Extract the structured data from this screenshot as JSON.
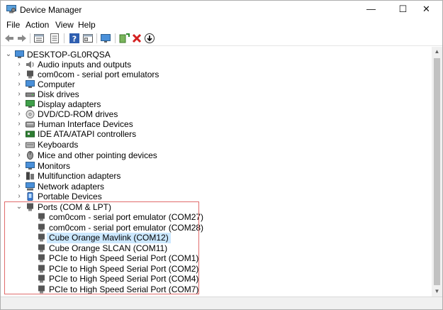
{
  "window": {
    "title": "Device Manager",
    "controls": {
      "minimize": "—",
      "maximize": "☐",
      "close": "✕"
    }
  },
  "menu": [
    "File",
    "Action",
    "View",
    "Help"
  ],
  "toolbar": [
    "back-icon",
    "forward-icon",
    "properties-view-icon",
    "list-view-icon",
    "help-icon",
    "details-view-icon",
    "monitor-icon",
    "add-driver-icon",
    "uninstall-icon",
    "update-driver-icon"
  ],
  "tree": {
    "root": "DESKTOP-GL0RQSA",
    "categories": [
      {
        "label": "Audio inputs and outputs",
        "icon": "speaker-icon"
      },
      {
        "label": "com0com - serial port emulators",
        "icon": "port-icon"
      },
      {
        "label": "Computer",
        "icon": "computer-icon"
      },
      {
        "label": "Disk drives",
        "icon": "disk-icon"
      },
      {
        "label": "Display adapters",
        "icon": "display-icon"
      },
      {
        "label": "DVD/CD-ROM drives",
        "icon": "dvd-icon"
      },
      {
        "label": "Human Interface Devices",
        "icon": "hid-icon"
      },
      {
        "label": "IDE ATA/ATAPI controllers",
        "icon": "ide-icon"
      },
      {
        "label": "Keyboards",
        "icon": "keyboard-icon"
      },
      {
        "label": "Mice and other pointing devices",
        "icon": "mouse-icon"
      },
      {
        "label": "Monitors",
        "icon": "monitor-icon"
      },
      {
        "label": "Multifunction adapters",
        "icon": "multifunction-icon"
      },
      {
        "label": "Network adapters",
        "icon": "network-icon"
      },
      {
        "label": "Portable Devices",
        "icon": "portable-icon"
      }
    ],
    "ports": {
      "label": "Ports (COM & LPT)",
      "children": [
        "com0com - serial port emulator (COM27)",
        "com0com - serial port emulator (COM28)",
        "Cube Orange Mavlink (COM12)",
        "Cube Orange SLCAN (COM11)",
        "PCIe to High Speed Serial Port (COM1)",
        "PCIe to High Speed Serial Port (COM2)",
        "PCIe to High Speed Serial Port (COM4)",
        "PCIe to High Speed Serial Port (COM7)"
      ],
      "selected": "Cube Orange Mavlink (COM12)"
    }
  },
  "colors": {
    "selection": "#cce8ff",
    "highlight_box": "#e06c6c",
    "accent": "#1e73be"
  }
}
